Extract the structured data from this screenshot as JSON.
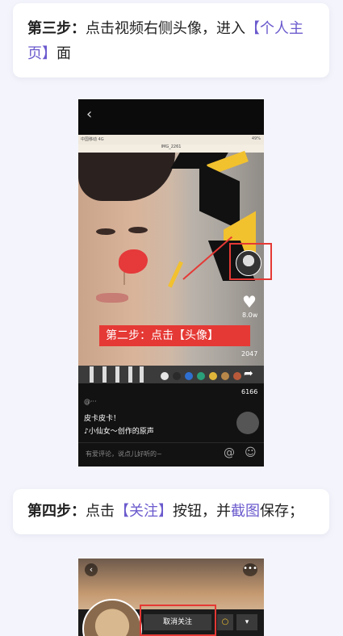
{
  "step3": {
    "label": "第三步：",
    "text_before": "点击视频右侧头像，进入",
    "highlight": "【个人主页】",
    "text_after": "面"
  },
  "screenshot1": {
    "back_icon": "chevron-left-icon",
    "status_left": "中国移动 4G",
    "status_right": "49%",
    "video_title": "IMG_2261",
    "likes": "8.0w",
    "comments": "2047",
    "shares": "6166",
    "caption": "皮卡皮卡！",
    "music": "♪小仙女～创作的原声",
    "comment_placeholder": "有爱评论，说点儿好听的~",
    "at_symbol": "@",
    "callout": "第二步：点击【头像】",
    "palette": [
      "#e5e5e5",
      "#2a2a2a",
      "#2f6fd0",
      "#2aa07a",
      "#e0b63a",
      "#b8884a",
      "#b85a3a"
    ]
  },
  "step4": {
    "label": "第四步：",
    "text_a": "点击",
    "highlight1": "【关注】",
    "text_b": "按钮，并",
    "highlight2": "截图",
    "text_c": "保存；"
  },
  "screenshot2": {
    "back_icon": "‹",
    "more_icon": "•••",
    "unfollow": "取消关注",
    "dropdown_icon": "▾",
    "message_icon": "○"
  }
}
